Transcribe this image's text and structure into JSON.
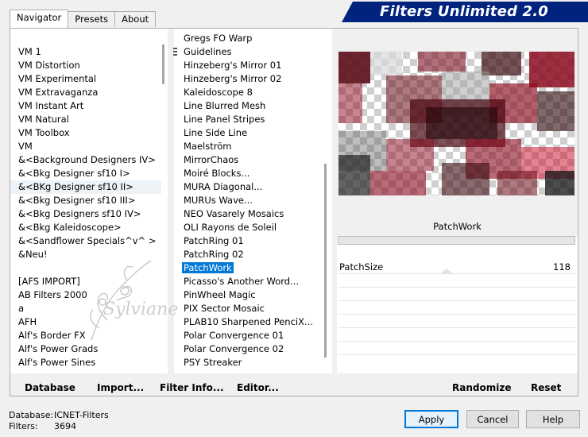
{
  "tabs": [
    {
      "label": "Navigator",
      "active": true
    },
    {
      "label": "Presets",
      "active": false
    },
    {
      "label": "About",
      "active": false
    }
  ],
  "banner": {
    "title": "Filters Unlimited 2.0",
    "color": "#00237d"
  },
  "categories": [
    "VM 1",
    "VM Distortion",
    "VM Experimental",
    "VM Extravaganza",
    "VM Instant Art",
    "VM Natural",
    "VM Toolbox",
    "VM",
    "&<Background Designers IV>",
    "&<Bkg Designer sf10 I>",
    "&<BKg Designer sf10 II>",
    "&<Bkg Designer sf10 III>",
    "&<Bkg Designers sf10 IV>",
    "&<Bkg Kaleidoscope>",
    "&<Sandflower Specials^v^ >",
    "&Neu!",
    "",
    "[AFS IMPORT]",
    "AB Filters 2000",
    "a",
    "AFH",
    "Alf's Border FX",
    "Alf's Power Grads",
    "Alf's Power Sines"
  ],
  "category_hovered": "&<BKg Designer sf10 II>",
  "filters": [
    "Gregs FO Warp",
    "Guidelines",
    "Hinzeberg's Mirror 01",
    "Hinzeberg's Mirror 02",
    "Kaleidoscope 8",
    "Line Blurred Mesh",
    "Line Panel Stripes",
    "Line Side Line",
    "Maelström",
    "MirrorChaos",
    "Moiré Blocks...",
    "MURA Diagonal...",
    "MURUs Wave...",
    "NEO Vasarely Mosaics",
    "OLI Rayons de Soleil",
    "PatchRing 01",
    "PatchRing 02",
    "PatchWork",
    "Picasso's Another Word...",
    "PinWheel Magic",
    "PIX Sector Mosaic",
    "PLAB10 Sharpened PenciX...",
    "Polar Convergence 01",
    "Polar Convergence 02",
    "PSY Streaker"
  ],
  "filter_selected": "PatchWork",
  "watermark": "Sylviane",
  "bottom_buttons": {
    "database": "Database",
    "import": "Import...",
    "filter_info": "Filter Info...",
    "editor": "Editor...",
    "randomize": "Randomize",
    "reset": "Reset"
  },
  "preview": {
    "filter_name": "PatchWork",
    "params": [
      {
        "label": "PatchSize",
        "value": "118"
      }
    ],
    "empty_rows": 6
  },
  "footer": {
    "database_label": "Database:",
    "database_value": "ICNET-Filters",
    "filters_label": "Filters:",
    "filters_value": "3694"
  },
  "dialog_buttons": {
    "apply": "Apply",
    "cancel": "Cancel",
    "help": "Help"
  },
  "colors": {
    "selection": "#0078d7",
    "banner": "#00237d",
    "preview_red": "#8b0a1e"
  }
}
